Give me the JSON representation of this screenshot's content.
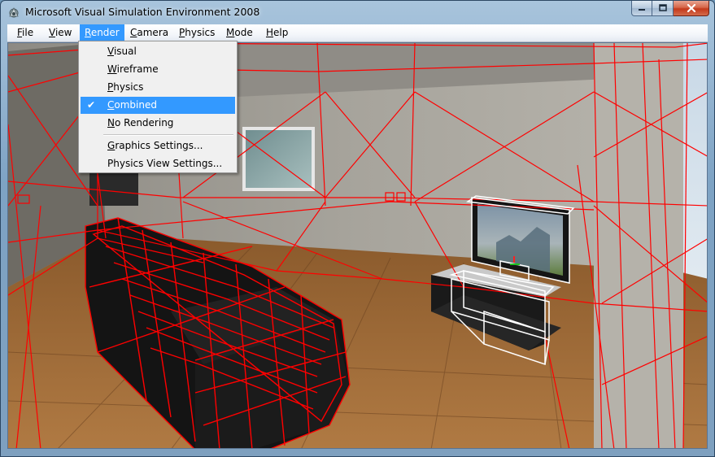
{
  "window": {
    "title": "Microsoft Visual Simulation Environment 2008"
  },
  "menubar": {
    "items": [
      {
        "id": "file",
        "mnemonic": "F",
        "rest": "ile"
      },
      {
        "id": "view",
        "mnemonic": "V",
        "rest": "iew"
      },
      {
        "id": "render",
        "mnemonic": "R",
        "rest": "ender",
        "active": true
      },
      {
        "id": "camera",
        "mnemonic": "C",
        "rest": "amera"
      },
      {
        "id": "physics",
        "mnemonic": "P",
        "rest": "hysics"
      },
      {
        "id": "mode",
        "mnemonic": "M",
        "rest": "ode"
      },
      {
        "id": "help",
        "mnemonic": "H",
        "rest": "elp"
      }
    ]
  },
  "render_menu": {
    "items": [
      {
        "id": "visual",
        "mnemonic": "V",
        "rest": "isual",
        "checked": false
      },
      {
        "id": "wireframe",
        "mnemonic": "W",
        "rest": "ireframe",
        "checked": false
      },
      {
        "id": "physics",
        "mnemonic": "P",
        "rest": "hysics",
        "checked": false
      },
      {
        "id": "combined",
        "mnemonic": "C",
        "rest": "ombined",
        "checked": true,
        "selected": true
      },
      {
        "id": "no-rendering",
        "mnemonic": "N",
        "rest": "o Rendering",
        "checked": false
      },
      {
        "id": "graphics-settings",
        "mnemonic": "G",
        "rest": "raphics Settings...",
        "checked": false
      },
      {
        "id": "physics-view-settings",
        "mnemonic": "",
        "rest": "Physics View Settings...",
        "checked": false
      }
    ],
    "check_glyph": "✔"
  },
  "colors": {
    "accent": "#3399ff",
    "physics_wire": "#ff0000",
    "tv_wire": "#ffffff"
  }
}
